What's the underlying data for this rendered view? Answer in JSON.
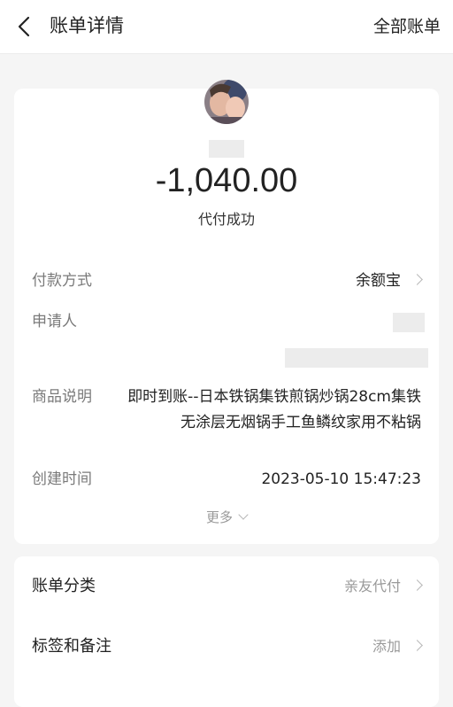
{
  "nav": {
    "title": "账单详情",
    "right_link": "全部账单"
  },
  "summary": {
    "amount": "-1,040.00",
    "status": "代付成功"
  },
  "details": {
    "payment_method_label": "付款方式",
    "payment_method_value": "余额宝",
    "applicant_label": "申请人",
    "product_label": "商品说明",
    "product_value": "即时到账--日本铁锅集铁煎锅炒锅28cm集铁无涂层无烟锅手工鱼鳞纹家用不粘锅",
    "created_label": "创建时间",
    "created_value": "2023-05-10 15:47:23",
    "more_label": "更多"
  },
  "extra": {
    "category_label": "账单分类",
    "category_value": "亲友代付",
    "tags_label": "标签和备注",
    "tags_value": "添加"
  },
  "icons": [
    "back-arrow-icon",
    "chevron-right-icon",
    "chevron-down-icon"
  ],
  "colors": {
    "background": "#f5f5f5",
    "card": "#ffffff",
    "label": "#7a7a7a",
    "muted": "#999999"
  }
}
